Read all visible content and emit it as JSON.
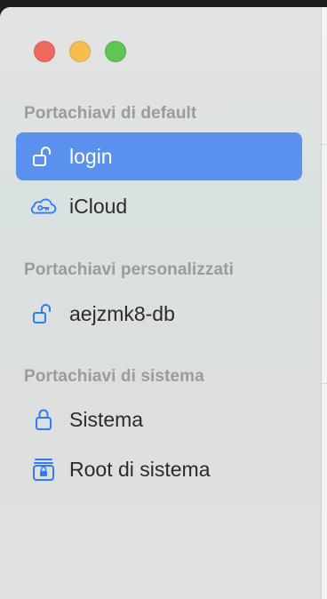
{
  "window": {
    "controls": {
      "close": "close-button",
      "minimize": "minimize-button",
      "zoom": "zoom-button"
    }
  },
  "sidebar": {
    "sections": [
      {
        "header": "Portachiavi di default",
        "items": [
          {
            "label": "login",
            "icon": "unlocked-padlock-icon",
            "selected": true
          },
          {
            "label": "iCloud",
            "icon": "icloud-key-icon",
            "selected": false
          }
        ]
      },
      {
        "header": "Portachiavi personalizzati",
        "items": [
          {
            "label": "aejzmk8-db",
            "icon": "unlocked-padlock-icon",
            "selected": false
          }
        ]
      },
      {
        "header": "Portachiavi di sistema",
        "items": [
          {
            "label": "Sistema",
            "icon": "locked-padlock-icon",
            "selected": false
          },
          {
            "label": "Root di sistema",
            "icon": "locked-padlock-archive-icon",
            "selected": false
          }
        ]
      }
    ]
  },
  "colors": {
    "accent": "#5a91ef",
    "icon_blue": "#2f7cf6",
    "section_header": "#9b9b9b",
    "close": "#ee6a5f",
    "minimize": "#f5bf4f",
    "zoom": "#61c554"
  }
}
